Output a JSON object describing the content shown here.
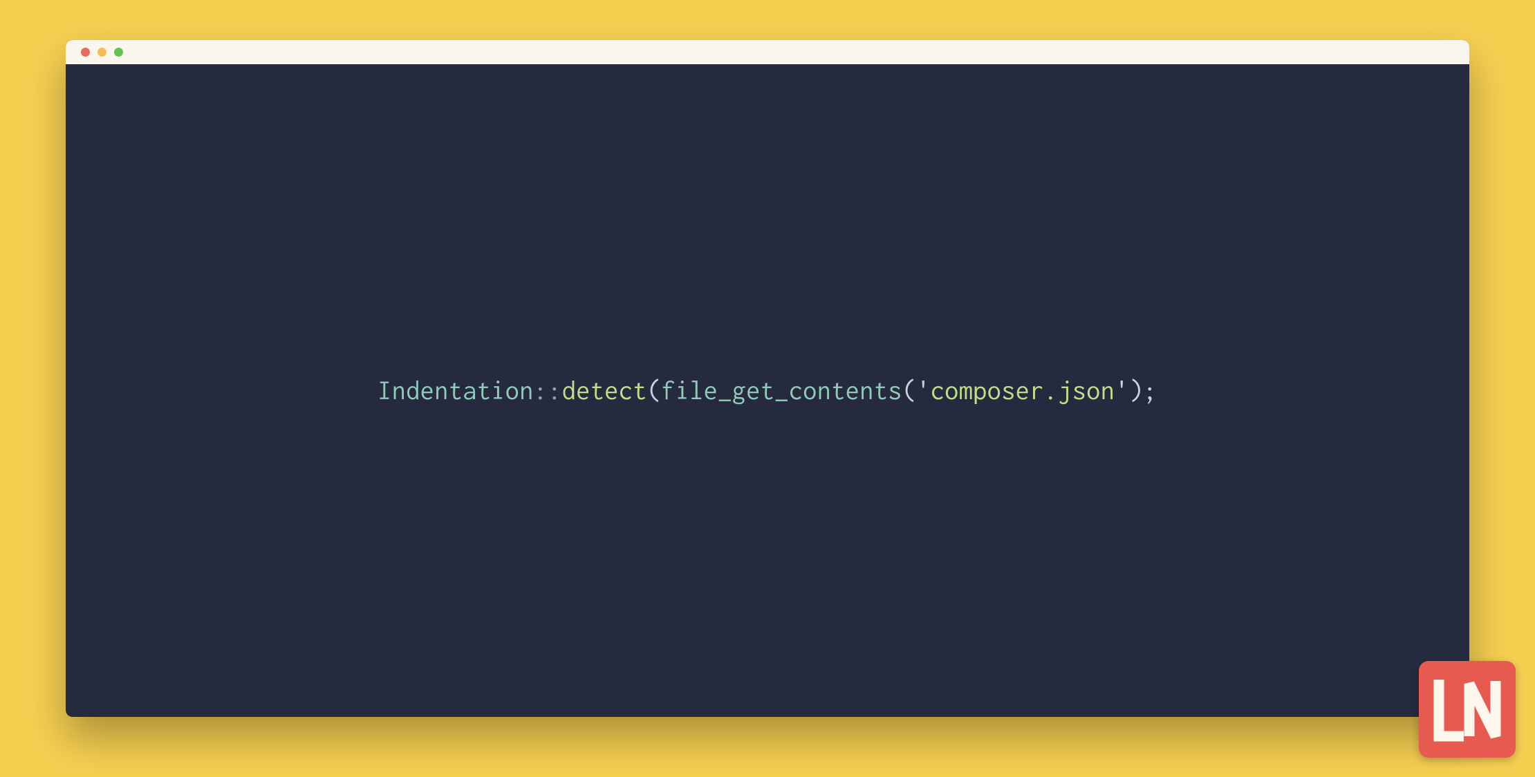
{
  "colors": {
    "background": "#f6cf51",
    "editor_bg": "#262a3f",
    "titlebar_bg": "#fbf6ed",
    "traffic_red": "#ec695e",
    "traffic_yellow": "#f4be50",
    "traffic_green": "#61c454",
    "logo_bg": "#e65a4f",
    "logo_fg": "#fdf6ec",
    "token_class": "#8fcbb8",
    "token_op": "#96a0ac",
    "token_method": "#bde086",
    "token_paren": "#c9d1df",
    "token_func": "#8fcbb8",
    "token_string": "#bde086"
  },
  "code": {
    "tokens": [
      {
        "kind": "class",
        "text": "Indentation"
      },
      {
        "kind": "op",
        "text": "::"
      },
      {
        "kind": "method",
        "text": "detect"
      },
      {
        "kind": "paren",
        "text": "("
      },
      {
        "kind": "func",
        "text": "file_get_contents"
      },
      {
        "kind": "paren",
        "text": "("
      },
      {
        "kind": "quote",
        "text": "'"
      },
      {
        "kind": "string",
        "text": "composer.json"
      },
      {
        "kind": "quote",
        "text": "'"
      },
      {
        "kind": "paren",
        "text": ")"
      },
      {
        "kind": "semi",
        "text": ";"
      }
    ]
  },
  "logo": {
    "text": "LN"
  }
}
